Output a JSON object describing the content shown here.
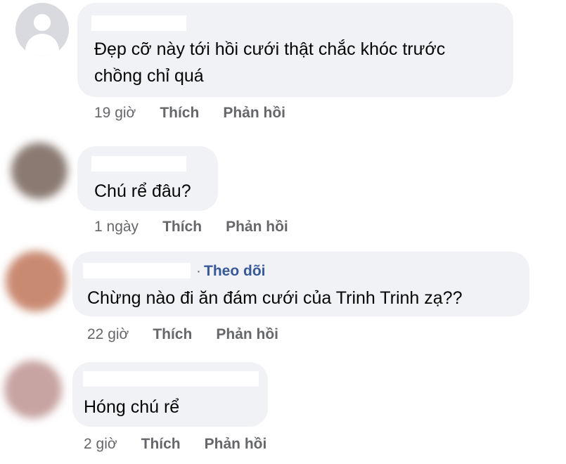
{
  "comments": [
    {
      "avatar": "default-avatar",
      "avatar_color": "#d8dadf",
      "follow": "",
      "text": "Đẹp cỡ này tới hồi cưới thật chắc khóc trước\nchồng chỉ quá",
      "time": "19 giờ",
      "like": "Thích",
      "reply": "Phản hồi"
    },
    {
      "avatar": "blurred-avatar",
      "avatar_color": "#8a7a72",
      "follow": "",
      "text": "Chú rể đâu?",
      "time": "1 ngày",
      "like": "Thích",
      "reply": "Phản hồi"
    },
    {
      "avatar": "blurred-avatar",
      "avatar_color": "#c98a72",
      "follow": "Theo dõi",
      "follow_dot": "·",
      "text": "Chừng nào đi ăn đám cưới của Trinh Trinh zạ??",
      "time": "22 giờ",
      "like": "Thích",
      "reply": "Phản hồi"
    },
    {
      "avatar": "blurred-avatar",
      "avatar_color": "#c7a3a2",
      "follow": "",
      "text": "Hóng chú rể",
      "time": "2 giờ",
      "like": "Thích",
      "reply": "Phản hồi"
    }
  ],
  "colors": {
    "bubble": "#f0f2f5",
    "text": "#050505",
    "meta": "#65676b",
    "follow_link": "#385898"
  }
}
